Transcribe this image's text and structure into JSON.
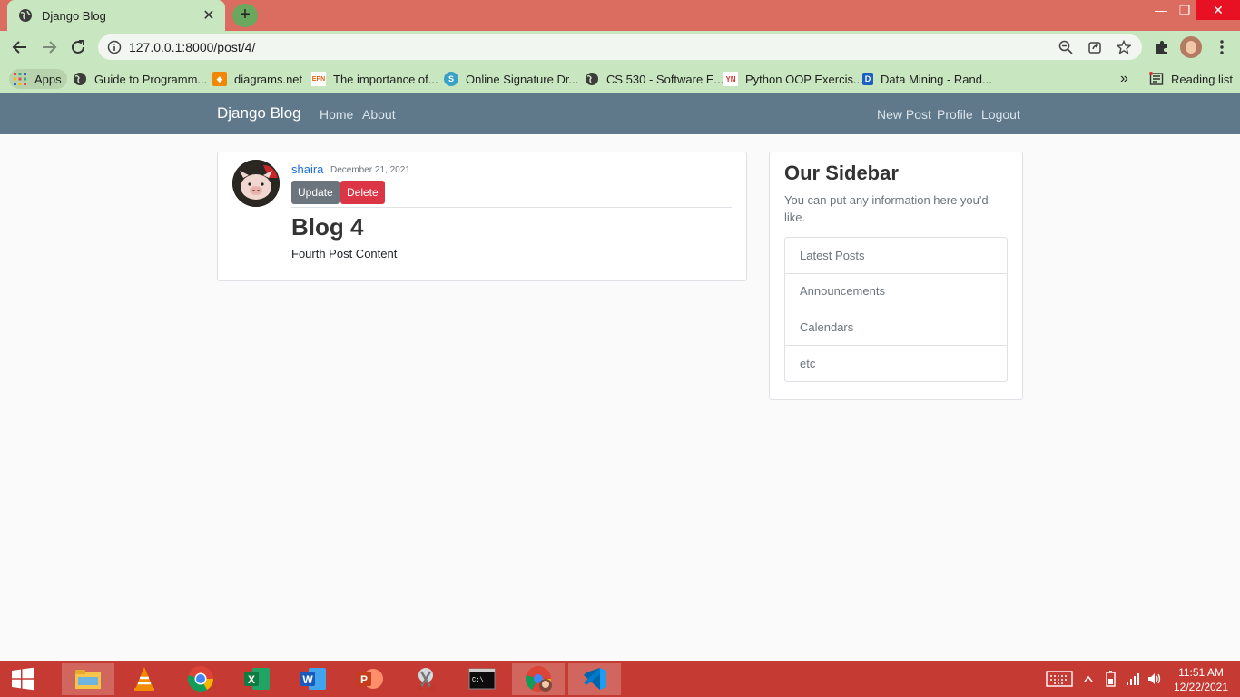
{
  "browser": {
    "tab_title": "Django Blog",
    "tab_close": "✕",
    "new_tab": "+",
    "window_controls": {
      "minimize": "—",
      "restore": "❐",
      "close": "✕"
    },
    "url": "127.0.0.1:8000/post/4/",
    "bookmarks": [
      {
        "label": "Apps",
        "icon": "apps-grid-icon"
      },
      {
        "label": "Guide to Programm...",
        "icon": "globe-icon"
      },
      {
        "label": "diagrams.net",
        "icon": "diagrams-icon",
        "color": "#f08705"
      },
      {
        "label": "The importance of...",
        "icon": "epn-icon"
      },
      {
        "label": "Online Signature Dr...",
        "icon": "signature-icon",
        "color": "#39a0c8"
      },
      {
        "label": "CS 530 - Software E...",
        "icon": "globe-icon"
      },
      {
        "label": "Python OOP Exercis...",
        "icon": "pynative-icon"
      },
      {
        "label": "Data Mining - Rand...",
        "icon": "d-icon",
        "color": "#1b5fc1"
      }
    ],
    "more_bookmarks": "»",
    "reading_list": "Reading list"
  },
  "navbar": {
    "brand": "Django Blog",
    "left_links": [
      "Home",
      "About"
    ],
    "right_links": [
      "New Post",
      "Profile",
      "Logout"
    ],
    "color": "#5f788a"
  },
  "post": {
    "author": "shaira",
    "date": "December 21, 2021",
    "update_label": "Update",
    "delete_label": "Delete",
    "title": "Blog 4",
    "content": "Fourth Post Content"
  },
  "sidebar": {
    "title": "Our Sidebar",
    "text": "You can put any information here you'd like.",
    "items": [
      "Latest Posts",
      "Announcements",
      "Calendars",
      "etc"
    ]
  },
  "taskbar": {
    "apps": [
      "file-explorer-icon",
      "vlc-icon",
      "chrome-icon",
      "excel-icon",
      "word-icon",
      "powerpoint-icon",
      "snipping-tool-icon",
      "command-prompt-icon",
      "chrome-profile-icon",
      "vscode-icon"
    ],
    "time": "11:51 AM",
    "date": "12/22/2021",
    "color": "#c53b33"
  }
}
